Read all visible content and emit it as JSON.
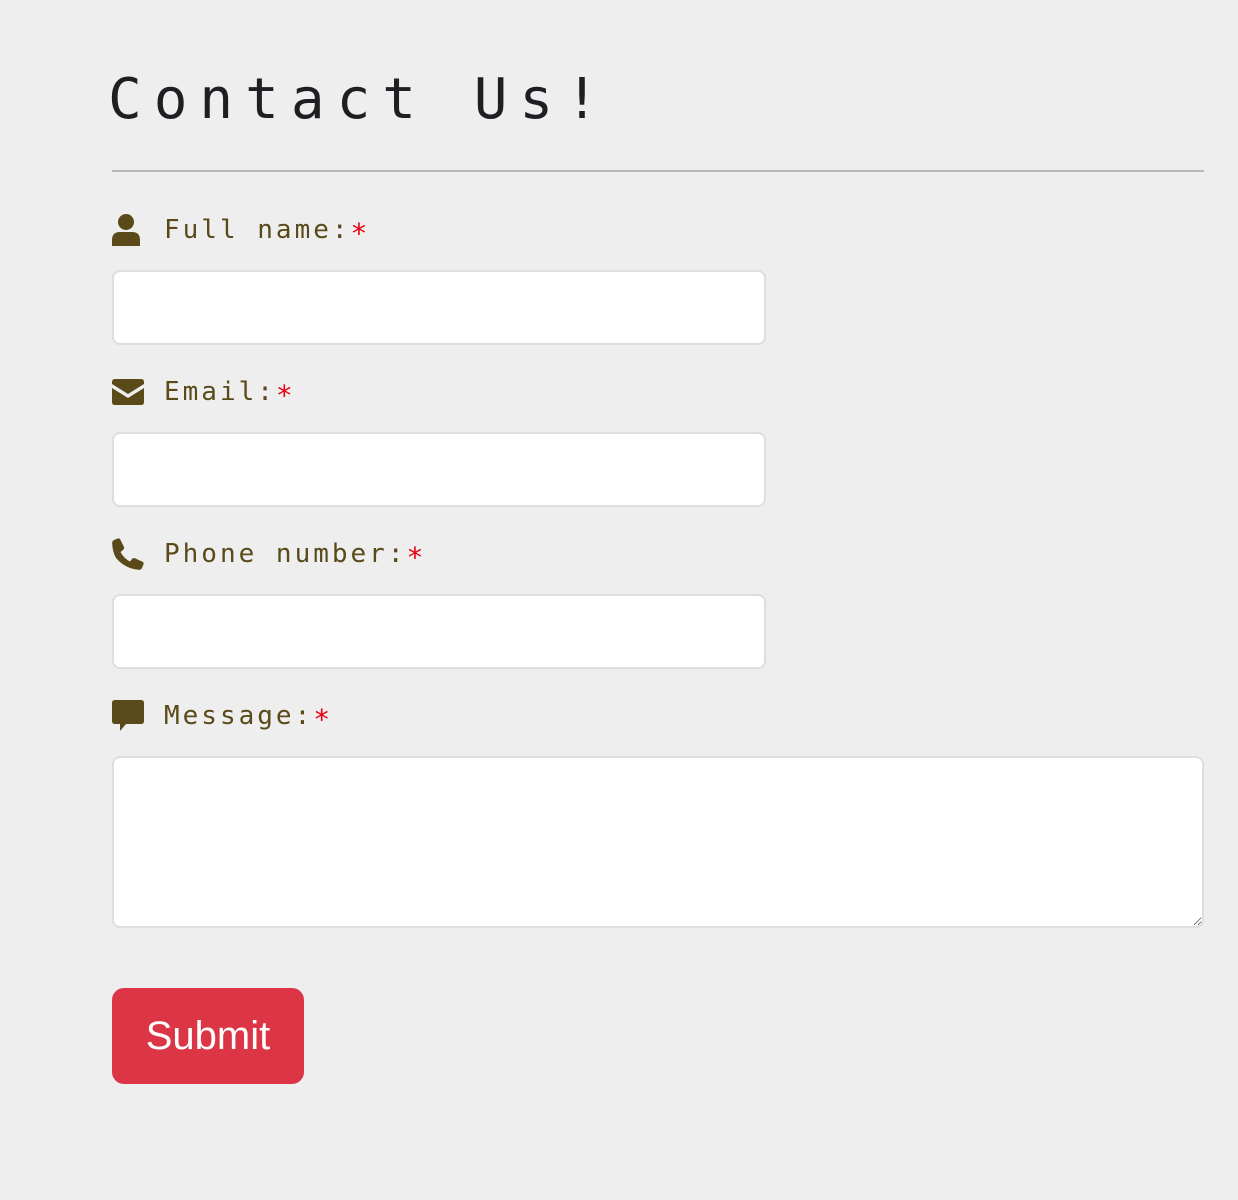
{
  "page": {
    "title": "Contact Us!"
  },
  "form": {
    "required_marker": "*",
    "fields": [
      {
        "label": "Full name:",
        "icon": "user-icon",
        "value": ""
      },
      {
        "label": "Email:",
        "icon": "envelope-icon",
        "value": ""
      },
      {
        "label": "Phone number:",
        "icon": "phone-icon",
        "value": ""
      },
      {
        "label": "Message:",
        "icon": "comment-icon",
        "value": ""
      }
    ],
    "submit_label": "Submit"
  },
  "colors": {
    "background": "#eeeeee",
    "title": "#1d1f22",
    "label": "#5a4a1a",
    "required": "#e8000f",
    "submit_button": "#dc3545",
    "submit_text": "#ffffff"
  }
}
